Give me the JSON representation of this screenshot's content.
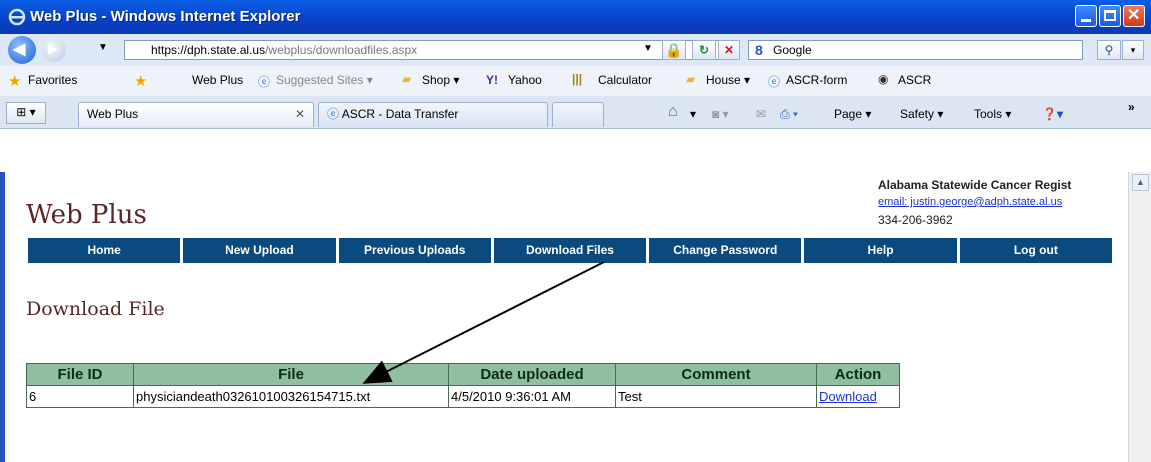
{
  "window": {
    "title": "Web Plus - Windows Internet Explorer"
  },
  "address_bar": {
    "url_scheme": "https://",
    "url_host": "dph.state.al.us",
    "url_path": "/webplus/downloadfiles.aspx",
    "search_label": "Google"
  },
  "favorites_bar": {
    "favorites_label": "Favorites",
    "items": [
      {
        "label": "Web Plus",
        "muted": false
      },
      {
        "label": "Suggested Sites ▾",
        "muted": true
      },
      {
        "label": "Shop ▾",
        "muted": false
      },
      {
        "label": "Yahoo",
        "muted": false
      },
      {
        "label": "Calculator",
        "muted": false
      },
      {
        "label": "House ▾",
        "muted": false
      },
      {
        "label": "ASCR-form",
        "muted": false
      },
      {
        "label": "ASCR",
        "muted": false
      }
    ]
  },
  "tabs": [
    {
      "label": "Web Plus",
      "active": true
    },
    {
      "label": "ASCR - Data Transfer",
      "active": false
    }
  ],
  "command_bar": {
    "page": "Page ▾",
    "safety": "Safety ▾",
    "tools": "Tools ▾"
  },
  "page": {
    "brand": "Web Plus",
    "org_name": "Alabama Statewide Cancer Regist",
    "email": "email: justin.george@adph.state.al.us",
    "phone": "334-206-3962",
    "menu": [
      "Home",
      "New Upload",
      "Previous Uploads",
      "Download Files",
      "Change Password",
      "Help",
      "Log out"
    ],
    "subtitle": "Download File",
    "table": {
      "headers": [
        "File ID",
        "File",
        "Date uploaded",
        "Comment",
        "Action"
      ],
      "rows": [
        {
          "id": "6",
          "file": "physiciandeath032610100326154715.txt",
          "date": "4/5/2010 9:36:01 AM",
          "comment": "Test",
          "action": "Download"
        }
      ]
    }
  },
  "colors": {
    "menu_bg": "#0b4a7e",
    "header_bg": "#8fbfa0",
    "brand_text": "#5b2626",
    "link": "#1b33d6"
  }
}
